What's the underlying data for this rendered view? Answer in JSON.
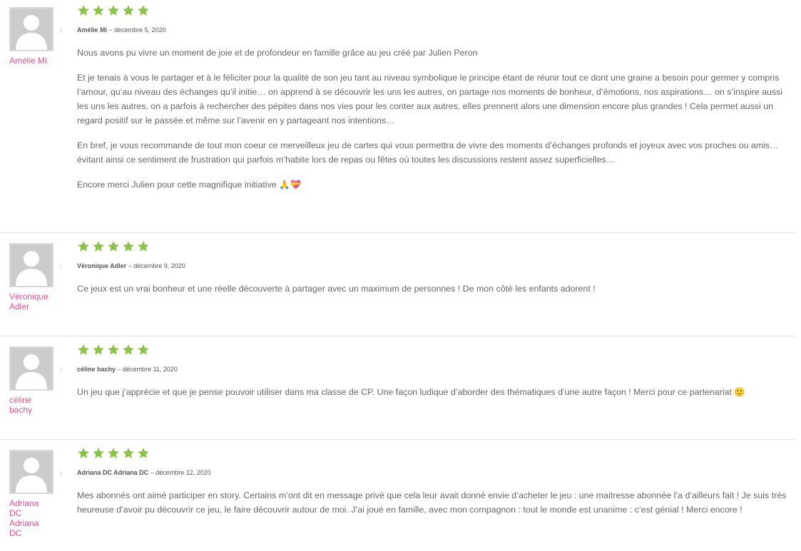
{
  "colors": {
    "star": "#8bc34a",
    "author_link": "#e2538d",
    "divider": "#e3e3e3"
  },
  "reviews": [
    {
      "side_name": "Amélie Mi",
      "rating": 5,
      "author": "Amélie Mi",
      "separator": " – ",
      "date": "décembre 5, 2020",
      "paragraphs": [
        "Nous avons pu vivre un moment de joie et de profondeur en famille grâce au jeu créé par Julien Peron",
        "Et je tenais à vous le partager et à le féliciter pour la qualité de son jeu tant au niveau symbolique le principe étant de réunir tout ce dont une graine a besoin pour germer y compris l’amour, qu’au niveau des échanges qu’il initie… on apprend à se découvrir les uns les autres, on partage nos moments de bonheur, d’émotions, nos aspirations… on s’inspire aussi les uns les autres, on a parfois à rechercher des pépites dans nos vies pour les conter aux autres, elles prennent alors une dimension encore plus grandes ! Cela permet aussi un regard positif sur le passée et même sur l’avenir en y partageant nos intentions…",
        "En bref, je vous recommande de tout mon coeur ce merveilleux jeu de cartes qui vous permettra de vivre des moments d’échanges profonds et joyeux avec vos proches ou amis… évitant ainsi ce sentiment de frustration qui parfois m’habite lors de repas ou fêtes où toutes les discussions restent assez superficielles…",
        "Encore merci Julien pour cette magnifique initiative 🙏💝"
      ]
    },
    {
      "side_name": "Véronique Adler",
      "rating": 5,
      "author": "Véronique Adler",
      "separator": " – ",
      "date": "décembre 9, 2020",
      "paragraphs": [
        "Ce jeux est un vrai bonheur et une réelle découverte à partager avec un maximum de personnes ! De mon côté les enfants adorent !"
      ]
    },
    {
      "side_name": "céline bachy",
      "rating": 5,
      "author": "céline bachy",
      "separator": " – ",
      "date": "décembre 11, 2020",
      "paragraphs": [
        "Un jeu que j’apprécie et que je pense pouvoir utiliser dans ma classe de CP. Une façon ludique d’aborder des thématiques d’une autre façon ! Merci pour ce partenariat 🙂"
      ]
    },
    {
      "side_name": "Adriana DC Adriana DC",
      "rating": 5,
      "author": "Adriana DC Adriana DC",
      "separator": " – ",
      "date": "décembre 12, 2020",
      "paragraphs": [
        "Mes abonnés ont aimé participer en story. Certains m’ont dit en message privé que cela leur avait donné envie d’acheter le jeu : une maitresse abonnée l’a d’ailleurs fait ! Je suis très heureuse d’avoir pu découvrir ce jeu, le faire découvrir autour de moi. J’ai joué en famille, avec mon compagnon : tout le monde est unanime : c’est génial ! Merci encore !"
      ]
    }
  ]
}
